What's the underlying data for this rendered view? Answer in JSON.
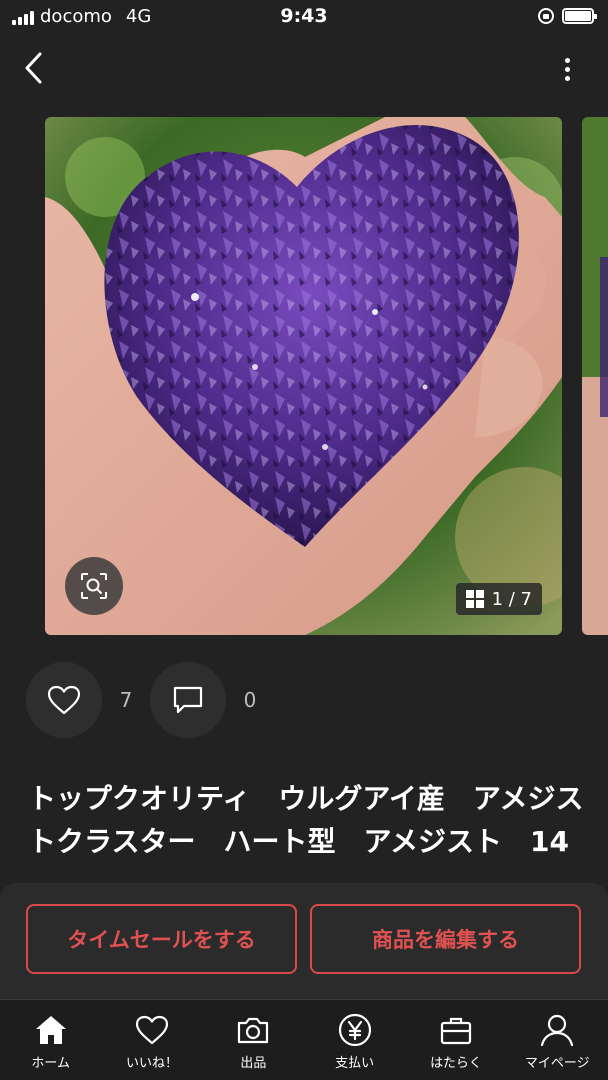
{
  "status_bar": {
    "carrier": "docomo",
    "network": "4G",
    "time": "9:43"
  },
  "header": {
    "back_icon": "chevron-left-icon",
    "more_icon": "vertical-ellipsis-icon"
  },
  "gallery": {
    "counter": "1 / 7",
    "zoom_icon": "image-search-icon"
  },
  "actions": {
    "like_count": "7",
    "comment_count": "0"
  },
  "product": {
    "title": "トップクオリティ　ウルグアイ産　アメジストクラスター　ハート型　アメジスト　14"
  },
  "sheet": {
    "time_sale_label": "タイムセールをする",
    "edit_label": "商品を編集する"
  },
  "tabs": [
    {
      "label": "ホーム",
      "icon": "home-icon"
    },
    {
      "label": "いいね！",
      "icon": "heart-icon"
    },
    {
      "label": "出品",
      "icon": "camera-icon"
    },
    {
      "label": "支払い",
      "icon": "yen-icon"
    },
    {
      "label": "はたらく",
      "icon": "briefcase-icon"
    },
    {
      "label": "マイページ",
      "icon": "person-icon"
    }
  ],
  "colors": {
    "background": "#222222",
    "accent": "#e05252",
    "tab_bar": "#1d1d1d"
  }
}
